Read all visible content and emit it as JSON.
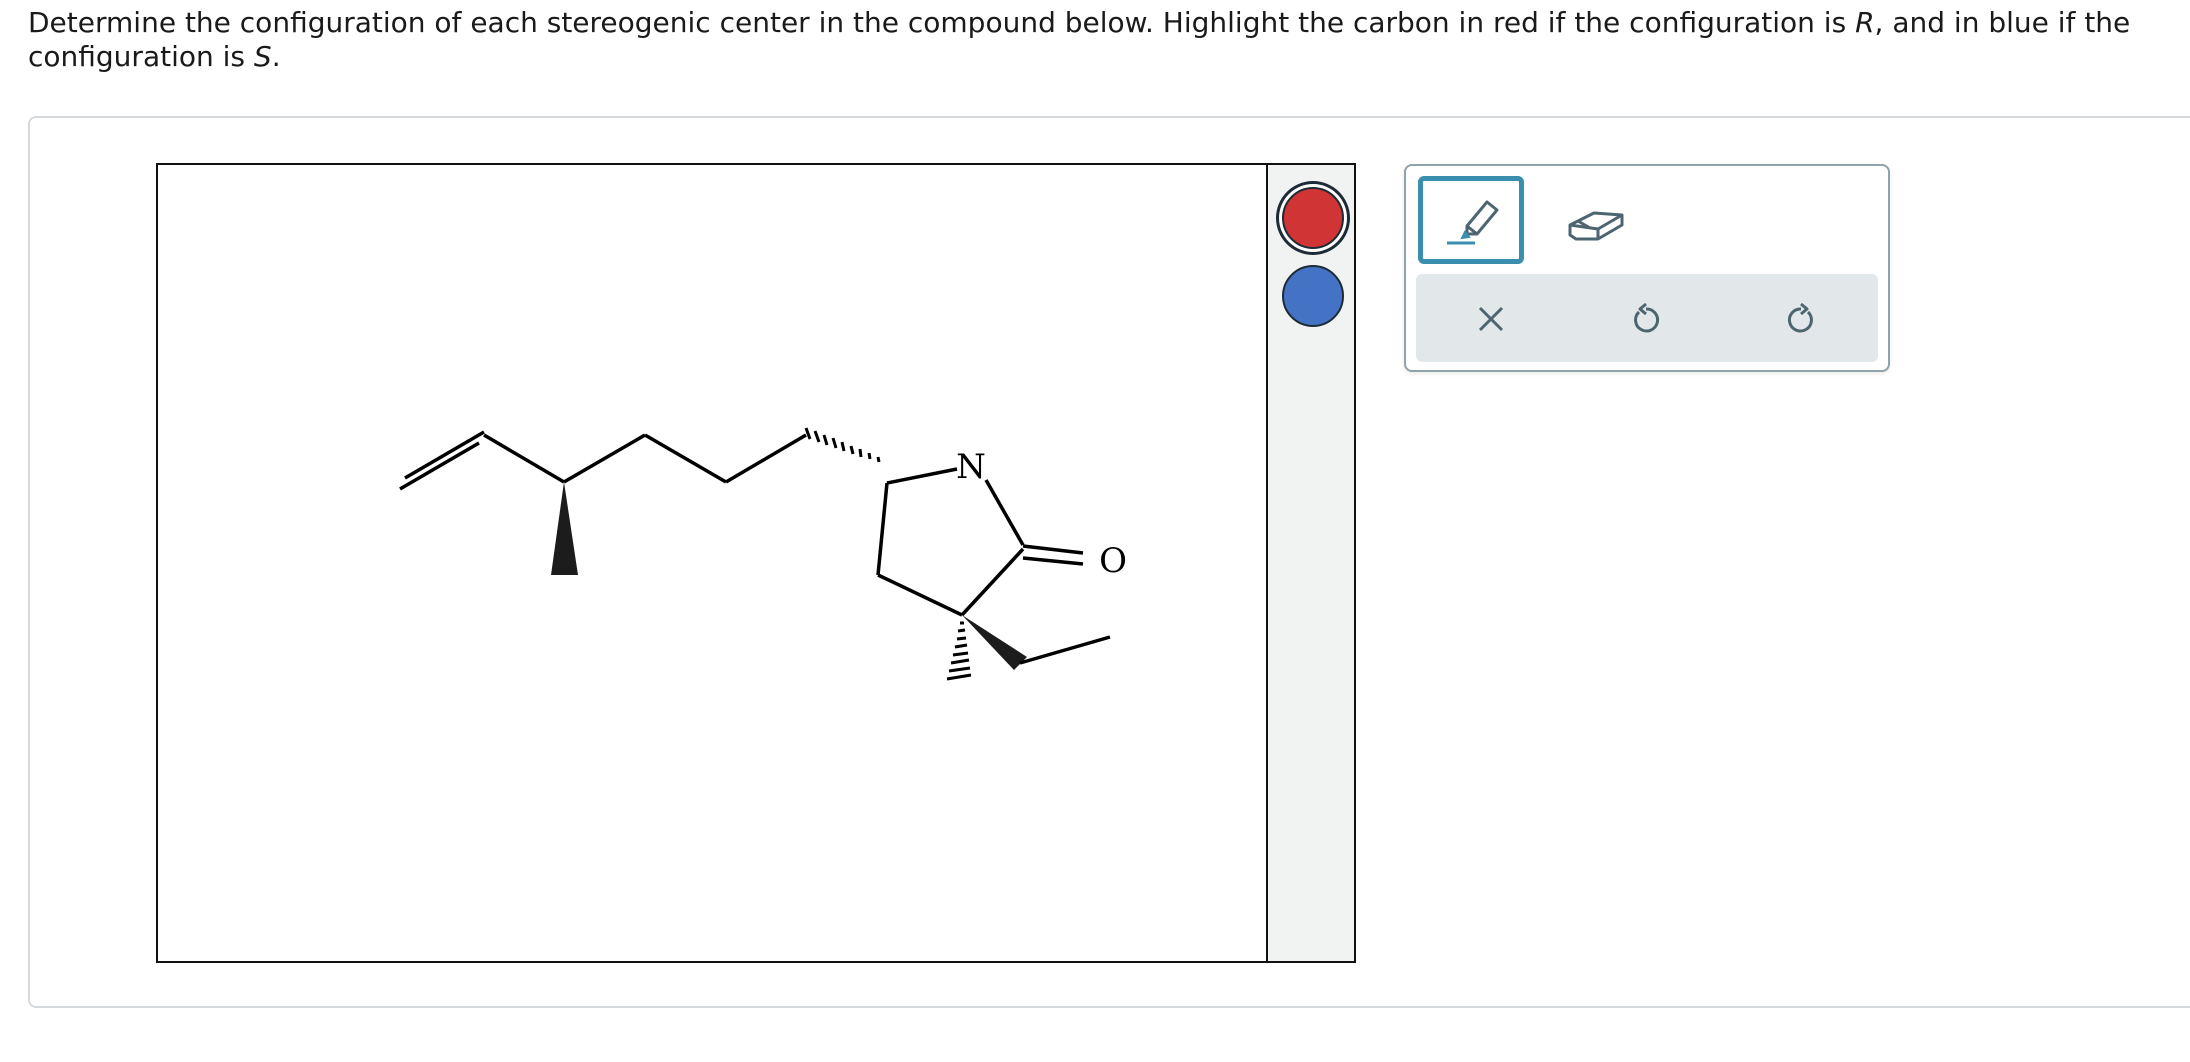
{
  "question": {
    "part1": "Determine the configuration of each stereogenic center in the compound below. Highlight the carbon in red if the configuration is ",
    "r_label": "R",
    "part2": ", and in blue if the configuration is ",
    "s_label": "S",
    "part3": "."
  },
  "molecule": {
    "atom_labels": {
      "nitrogen": "N",
      "oxygen": "O"
    }
  },
  "color_picker": {
    "options": [
      {
        "name": "red",
        "color": "#d03434",
        "selected": true
      },
      {
        "name": "blue",
        "color": "#4472c4",
        "selected": false
      }
    ]
  },
  "toolbox": {
    "tools": [
      "highlighter-icon",
      "eraser-icon"
    ],
    "active_tool": "highlighter",
    "actions": [
      "clear-icon",
      "undo-icon",
      "redo-icon"
    ],
    "icon_color": "#4d6570",
    "accent_color": "#3a8fae"
  }
}
